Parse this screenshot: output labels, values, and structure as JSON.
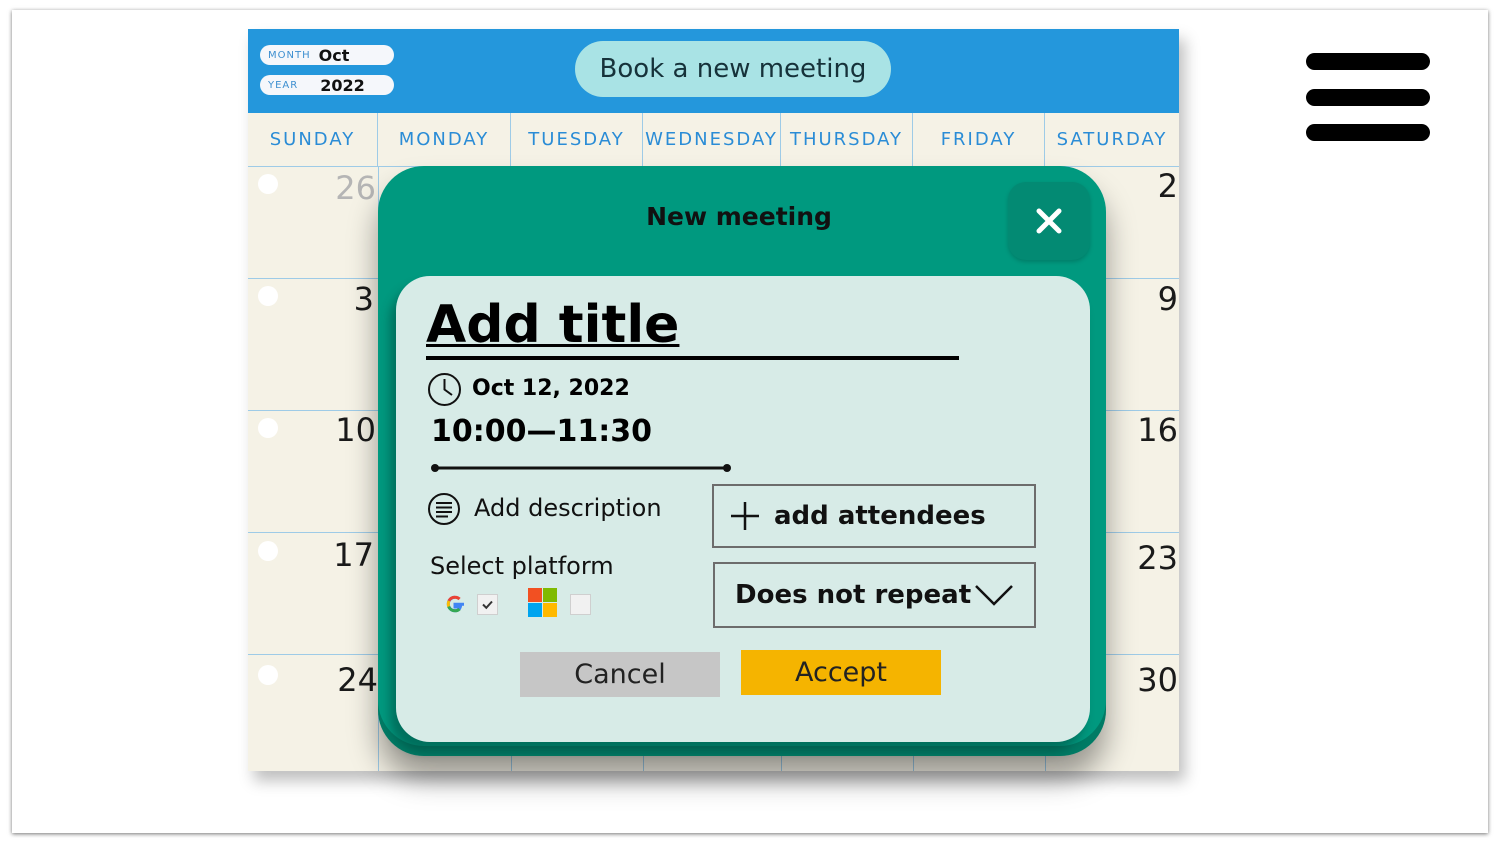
{
  "calendar": {
    "month_label": "MONTH",
    "month_value": "Oct",
    "year_label": "YEAR",
    "year_value": "2022",
    "book_button_label": "Book a new meeting",
    "weekdays": [
      "SUNDAY",
      "MONDAY",
      "TUESDAY",
      "WEDNESDAY",
      "THURSDAY",
      "FRIDAY",
      "SATURDAY"
    ],
    "visible_dates": {
      "sunday": [
        "26",
        "3",
        "10",
        "17",
        "24"
      ],
      "saturday": [
        "2",
        "9",
        "16",
        "23",
        "30"
      ]
    }
  },
  "modal": {
    "title": "New meeting",
    "title_field": "Add title",
    "date": "Oct 12, 2022",
    "time_range": "10:00—11:30",
    "description_placeholder": "Add description",
    "add_attendees_label": "add attendees",
    "platform_label": "Select platform",
    "platforms": [
      {
        "name": "google",
        "checked": true
      },
      {
        "name": "microsoft",
        "checked": false
      }
    ],
    "repeat_value": "Does not repeat",
    "cancel_label": "Cancel",
    "accept_label": "Accept"
  },
  "colors": {
    "header_blue": "#2497dc",
    "modal_green": "#00997f",
    "card_bg": "#d7ebe7",
    "accept": "#f5b400",
    "cancel": "#c6c6c6"
  },
  "icons": [
    "close-icon",
    "clock-icon",
    "description-icon",
    "plus-icon",
    "chevron-down-icon",
    "google-icon",
    "microsoft-icon",
    "menu-icon"
  ]
}
